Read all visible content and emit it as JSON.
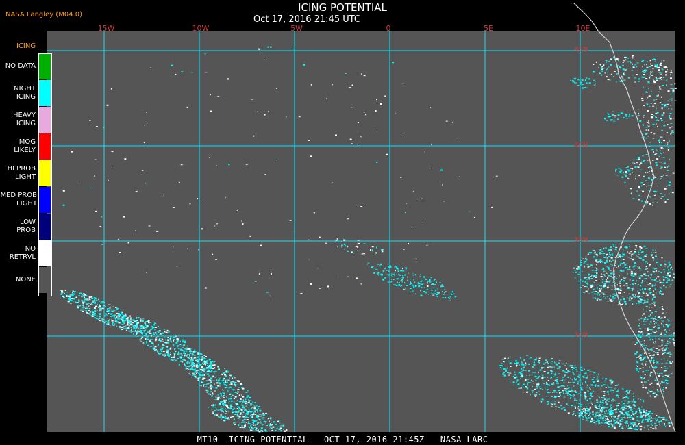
{
  "header": {
    "credit": "NASA Langley (M04.0)",
    "title": "ICING POTENTIAL",
    "subtitle": "Oct 17, 2016 21:45 UTC"
  },
  "footer": {
    "caption": "MT10  ICING POTENTIAL   OCT 17, 2016 21:45Z   NASA LARC"
  },
  "map": {
    "background_color": "#555555",
    "grid_color": "#00e8ff",
    "longitude_labels": [
      "15W",
      "10W",
      "5W",
      "0",
      "5E",
      "10E"
    ],
    "latitude_labels": [
      "45N",
      "40N",
      "35N",
      "30N"
    ],
    "colors": {
      "ice": "#00ffff",
      "no_retrieval": "#ffffff",
      "coast": "#d8d8d8"
    }
  },
  "legend": {
    "title": "ICING",
    "items": [
      {
        "label": "NO DATA",
        "color": "#00b000"
      },
      {
        "label": "NIGHT\nICING",
        "color": "#00ffff"
      },
      {
        "label": "HEAVY\nICING",
        "color": "#e8a8e0"
      },
      {
        "label": "MOG\nLIKELY",
        "color": "#ff0000"
      },
      {
        "label": "HI PROB\nLIGHT",
        "color": "#ffff00"
      },
      {
        "label": "MED PROB\nLIGHT",
        "color": "#0000ff"
      },
      {
        "label": "LOW\nPROB",
        "color": "#00007a"
      },
      {
        "label": "NO\nRETRVL",
        "color": "#ffffff"
      },
      {
        "label": "NONE",
        "color": "#555555"
      }
    ]
  }
}
